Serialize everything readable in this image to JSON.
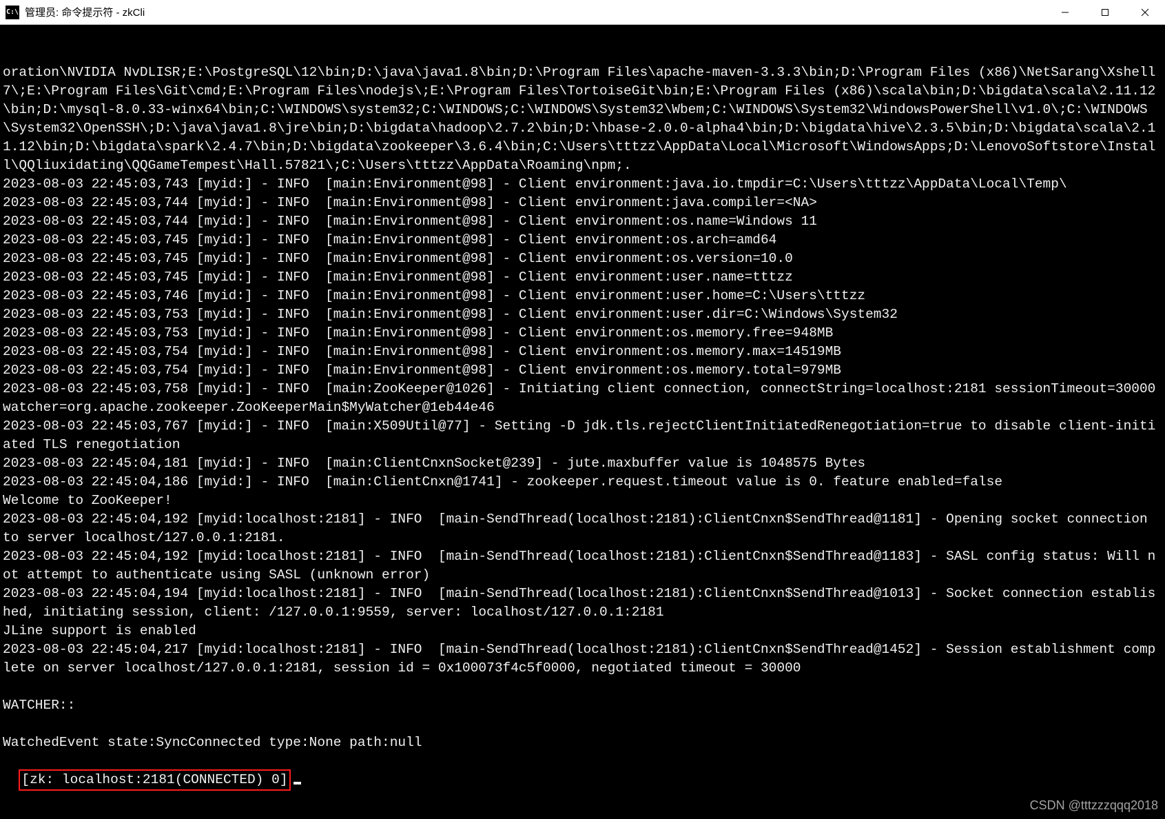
{
  "window": {
    "title": "管理员: 命令提示符 - zkCli",
    "icon_label": "C:\\"
  },
  "terminal": {
    "lines": [
      "oration\\NVIDIA NvDLISR;E:\\PostgreSQL\\12\\bin;D:\\java\\java1.8\\bin;D:\\Program Files\\apache-maven-3.3.3\\bin;D:\\Program Files (x86)\\NetSarang\\Xshell 7\\;E:\\Program Files\\Git\\cmd;E:\\Program Files\\nodejs\\;E:\\Program Files\\TortoiseGit\\bin;E:\\Program Files (x86)\\scala\\bin;D:\\bigdata\\scala\\2.11.12\\bin;D:\\mysql-8.0.33-winx64\\bin;C:\\WINDOWS\\system32;C:\\WINDOWS;C:\\WINDOWS\\System32\\Wbem;C:\\WINDOWS\\System32\\WindowsPowerShell\\v1.0\\;C:\\WINDOWS\\System32\\OpenSSH\\;D:\\java\\java1.8\\jre\\bin;D:\\bigdata\\hadoop\\2.7.2\\bin;D:\\hbase-2.0.0-alpha4\\bin;D:\\bigdata\\hive\\2.3.5\\bin;D:\\bigdata\\scala\\2.11.12\\bin;D:\\bigdata\\spark\\2.4.7\\bin;D:\\bigdata\\zookeeper\\3.6.4\\bin;C:\\Users\\tttzz\\AppData\\Local\\Microsoft\\WindowsApps;D:\\LenovoSoftstore\\Install\\QQliuxidating\\QQGameTempest\\Hall.57821\\;C:\\Users\\tttzz\\AppData\\Roaming\\npm;.",
      "2023-08-03 22:45:03,743 [myid:] - INFO  [main:Environment@98] - Client environment:java.io.tmpdir=C:\\Users\\tttzz\\AppData\\Local\\Temp\\",
      "2023-08-03 22:45:03,744 [myid:] - INFO  [main:Environment@98] - Client environment:java.compiler=<NA>",
      "2023-08-03 22:45:03,744 [myid:] - INFO  [main:Environment@98] - Client environment:os.name=Windows 11",
      "2023-08-03 22:45:03,745 [myid:] - INFO  [main:Environment@98] - Client environment:os.arch=amd64",
      "2023-08-03 22:45:03,745 [myid:] - INFO  [main:Environment@98] - Client environment:os.version=10.0",
      "2023-08-03 22:45:03,745 [myid:] - INFO  [main:Environment@98] - Client environment:user.name=tttzz",
      "2023-08-03 22:45:03,746 [myid:] - INFO  [main:Environment@98] - Client environment:user.home=C:\\Users\\tttzz",
      "2023-08-03 22:45:03,753 [myid:] - INFO  [main:Environment@98] - Client environment:user.dir=C:\\Windows\\System32",
      "2023-08-03 22:45:03,753 [myid:] - INFO  [main:Environment@98] - Client environment:os.memory.free=948MB",
      "2023-08-03 22:45:03,754 [myid:] - INFO  [main:Environment@98] - Client environment:os.memory.max=14519MB",
      "2023-08-03 22:45:03,754 [myid:] - INFO  [main:Environment@98] - Client environment:os.memory.total=979MB",
      "2023-08-03 22:45:03,758 [myid:] - INFO  [main:ZooKeeper@1026] - Initiating client connection, connectString=localhost:2181 sessionTimeout=30000 watcher=org.apache.zookeeper.ZooKeeperMain$MyWatcher@1eb44e46",
      "2023-08-03 22:45:03,767 [myid:] - INFO  [main:X509Util@77] - Setting -D jdk.tls.rejectClientInitiatedRenegotiation=true to disable client-initiated TLS renegotiation",
      "2023-08-03 22:45:04,181 [myid:] - INFO  [main:ClientCnxnSocket@239] - jute.maxbuffer value is 1048575 Bytes",
      "2023-08-03 22:45:04,186 [myid:] - INFO  [main:ClientCnxn@1741] - zookeeper.request.timeout value is 0. feature enabled=false",
      "Welcome to ZooKeeper!",
      "2023-08-03 22:45:04,192 [myid:localhost:2181] - INFO  [main-SendThread(localhost:2181):ClientCnxn$SendThread@1181] - Opening socket connection to server localhost/127.0.0.1:2181.",
      "2023-08-03 22:45:04,192 [myid:localhost:2181] - INFO  [main-SendThread(localhost:2181):ClientCnxn$SendThread@1183] - SASL config status: Will not attempt to authenticate using SASL (unknown error)",
      "2023-08-03 22:45:04,194 [myid:localhost:2181] - INFO  [main-SendThread(localhost:2181):ClientCnxn$SendThread@1013] - Socket connection established, initiating session, client: /127.0.0.1:9559, server: localhost/127.0.0.1:2181",
      "JLine support is enabled",
      "2023-08-03 22:45:04,217 [myid:localhost:2181] - INFO  [main-SendThread(localhost:2181):ClientCnxn$SendThread@1452] - Session establishment complete on server localhost/127.0.0.1:2181, session id = 0x100073f4c5f0000, negotiated timeout = 30000",
      "",
      "WATCHER::",
      "",
      "WatchedEvent state:SyncConnected type:None path:null"
    ],
    "prompt": "[zk: localhost:2181(CONNECTED) 0]"
  },
  "watermark": "CSDN @tttzzzqqq2018"
}
